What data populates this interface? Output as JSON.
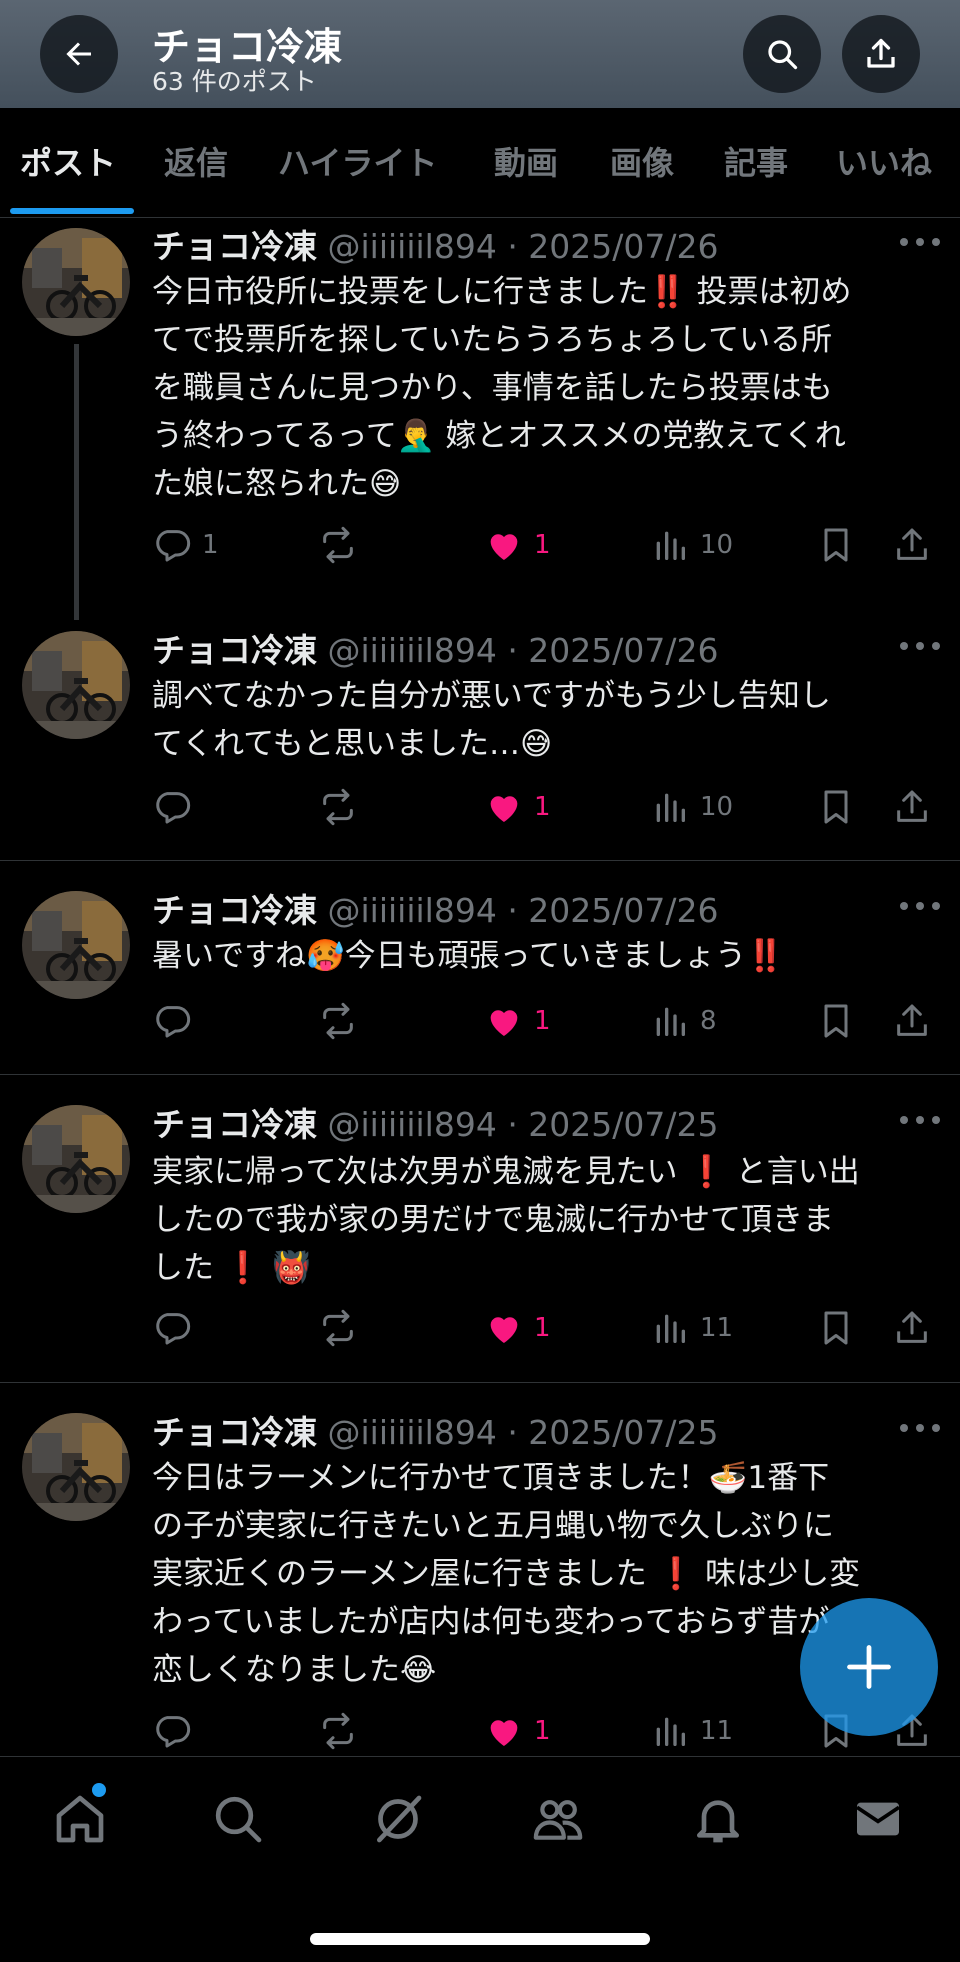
{
  "header": {
    "title": "チョコ冷凍",
    "subtitle": "63 件のポスト",
    "back_icon": "arrow-left-icon",
    "search_icon": "search-icon",
    "share_icon": "share-icon"
  },
  "tabs": [
    {
      "label": "ポスト",
      "active": true
    },
    {
      "label": "返信"
    },
    {
      "label": "ハイライト"
    },
    {
      "label": "動画"
    },
    {
      "label": "画像"
    },
    {
      "label": "記事"
    },
    {
      "label": "いいね"
    }
  ],
  "posts": [
    {
      "author": "チョコ冷凍",
      "meta": "@iiiiiiil894 · 2025/07/26",
      "text": "今日市役所に投票をしに行きました‼️ 投票は初め\nてで投票所を探していたらうろちょろしている所\nを職員さんに見つかり、事情を話したら投票はも\nう終わってるって🤦‍♂️ 嫁とオススメの党教えてくれ\nた娘に怒られた😅",
      "replies": "1",
      "likes": "1",
      "views": "10"
    },
    {
      "author": "チョコ冷凍",
      "meta": "@iiiiiiil894 · 2025/07/26",
      "text": "調べてなかった自分が悪いですがもう少し告知し\nてくれてもと思いました…😅",
      "replies": "",
      "likes": "1",
      "views": "10"
    },
    {
      "author": "チョコ冷凍",
      "meta": "@iiiiiiil894 · 2025/07/26",
      "text": "暑いですね🥵今日も頑張っていきましょう‼️",
      "replies": "",
      "likes": "1",
      "views": "8"
    },
    {
      "author": "チョコ冷凍",
      "meta": "@iiiiiiil894 · 2025/07/25",
      "text": "実家に帰って次は次男が鬼滅を見たい ❗️ と言い出\nしたので我が家の男だけで鬼滅に行かせて頂きま\nした ❗️ 👹",
      "replies": "",
      "likes": "1",
      "views": "11"
    },
    {
      "author": "チョコ冷凍",
      "meta": "@iiiiiiil894 · 2025/07/25",
      "text": "今日はラーメンに行かせて頂きました！🍜1番下\nの子が実家に行きたいと五月蝿い物で久しぶりに\n実家近くのラーメン屋に行きました ❗️ 味は少し変\nわっていましたが店内は何も変わっておらず昔が\n恋しくなりました😂",
      "replies": "",
      "likes": "1",
      "views": "11"
    }
  ],
  "action_icons": [
    "reply-icon",
    "repost-icon",
    "like-icon",
    "views-icon",
    "bookmark-icon",
    "share-icon"
  ],
  "fab": {
    "icon": "plus-icon"
  },
  "bottom_nav": [
    "home-icon",
    "search-icon",
    "grok-icon",
    "communities-icon",
    "notifications-icon",
    "messages-icon"
  ],
  "colors": {
    "accent": "#1d9bf0",
    "like": "#f91880",
    "muted": "#71767b",
    "text": "#e7e9ea",
    "background": "#000000"
  }
}
